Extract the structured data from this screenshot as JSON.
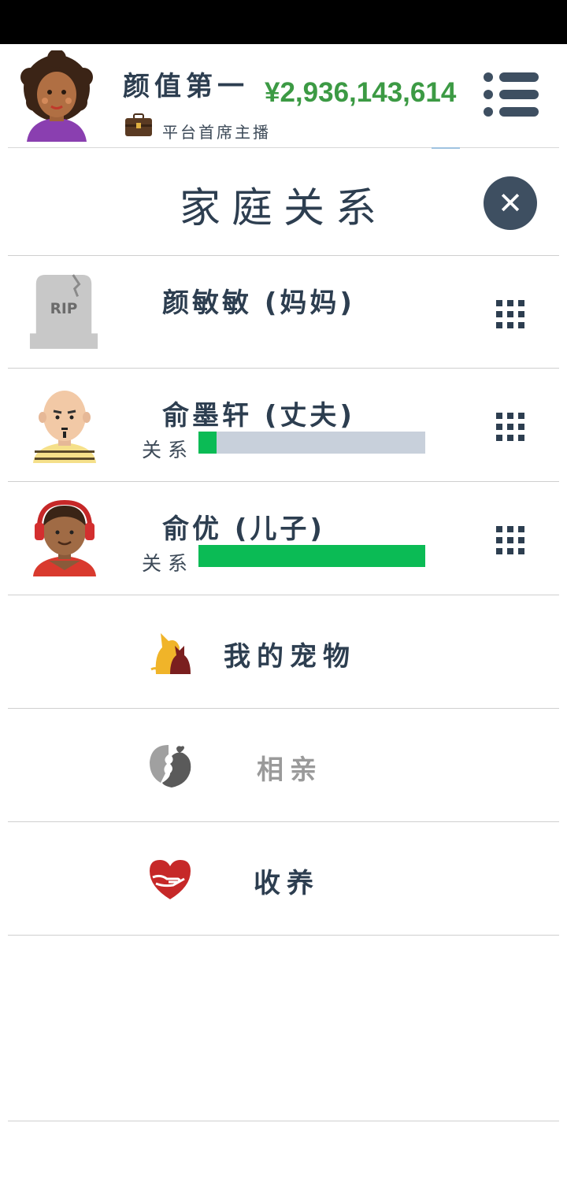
{
  "header": {
    "player_name": "颜值第一",
    "job_title": "平台首席主播",
    "money": "¥2,936,143,614"
  },
  "page": {
    "title": "家庭关系"
  },
  "family": [
    {
      "name": "颜敏敏 (妈妈)",
      "status": "deceased",
      "headstone_text": "RIP"
    },
    {
      "name": "俞墨轩 (丈夫)",
      "relation_label": "关系",
      "relation_level": 0.08
    },
    {
      "name": "俞优 (儿子)",
      "relation_label": "关系",
      "relation_level": 1.0
    }
  ],
  "menu": {
    "pets_label": "我的宠物",
    "dating_label": "相亲",
    "adopt_label": "收养"
  },
  "colors": {
    "money": "#3c9a44",
    "relation_fill": "#0bbb55",
    "relation_track": "#c8d0db",
    "text_dark": "#2d3e50"
  }
}
